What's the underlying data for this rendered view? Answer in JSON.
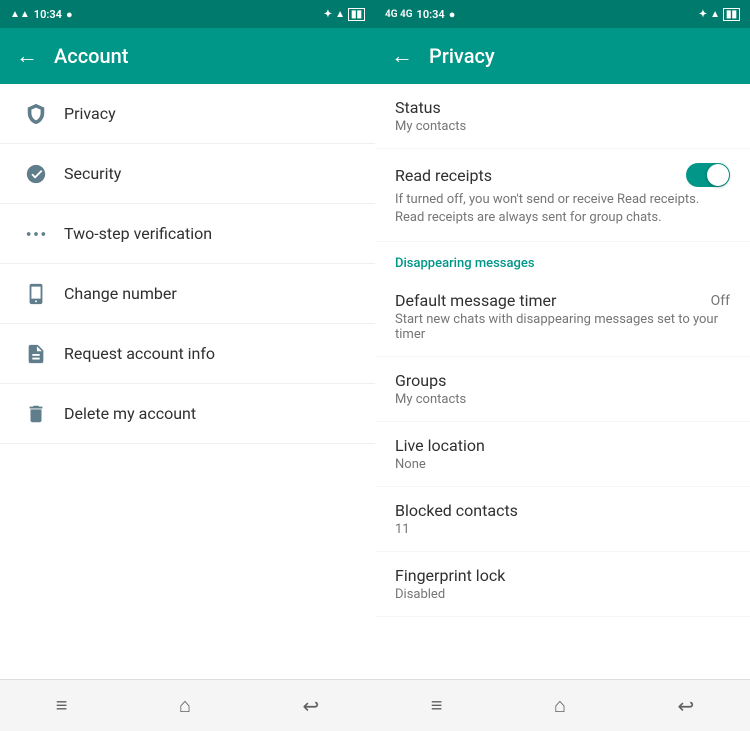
{
  "colors": {
    "header_bg": "#009688",
    "status_bar_bg": "#007a6c",
    "accent": "#009688",
    "text_primary": "#303030",
    "text_secondary": "#757575",
    "icon_color": "#607d8b"
  },
  "panel_account": {
    "status_bar": {
      "time": "10:34",
      "indicator": "●"
    },
    "header": {
      "back_label": "←",
      "title": "Account"
    },
    "menu_items": [
      {
        "id": "privacy",
        "label": "Privacy"
      },
      {
        "id": "security",
        "label": "Security"
      },
      {
        "id": "two-step",
        "label": "Two-step verification"
      },
      {
        "id": "change-number",
        "label": "Change number"
      },
      {
        "id": "request-info",
        "label": "Request account info"
      },
      {
        "id": "delete-account",
        "label": "Delete my account"
      }
    ],
    "bottom_nav": {
      "menu_icon": "≡",
      "home_icon": "⌂",
      "back_icon": "↩"
    }
  },
  "panel_privacy": {
    "status_bar": {
      "time": "10:34",
      "indicator": "●"
    },
    "header": {
      "back_label": "←",
      "title": "Privacy"
    },
    "items": [
      {
        "id": "status",
        "title": "Status",
        "subtitle": "My contacts",
        "value": "",
        "has_toggle": false,
        "has_description": false
      },
      {
        "id": "read-receipts",
        "title": "Read receipts",
        "subtitle": "",
        "description": "If turned off, you won't send or receive Read receipts. Read receipts are always sent for group chats.",
        "value": "",
        "has_toggle": true,
        "toggle_on": true,
        "has_description": true
      }
    ],
    "section_header": "Disappearing messages",
    "section_items": [
      {
        "id": "default-message-timer",
        "title": "Default message timer",
        "subtitle": "Start new chats with disappearing messages set to your timer",
        "value": "Off",
        "has_toggle": false
      }
    ],
    "other_items": [
      {
        "id": "groups",
        "title": "Groups",
        "subtitle": "My contacts",
        "value": "",
        "has_toggle": false
      },
      {
        "id": "live-location",
        "title": "Live location",
        "subtitle": "None",
        "value": "",
        "has_toggle": false
      },
      {
        "id": "blocked-contacts",
        "title": "Blocked contacts",
        "subtitle": "11",
        "value": "",
        "has_toggle": false
      },
      {
        "id": "fingerprint-lock",
        "title": "Fingerprint lock",
        "subtitle": "Disabled",
        "value": "",
        "has_toggle": false
      }
    ],
    "bottom_nav": {
      "menu_icon": "≡",
      "home_icon": "⌂",
      "back_icon": "↩"
    }
  }
}
